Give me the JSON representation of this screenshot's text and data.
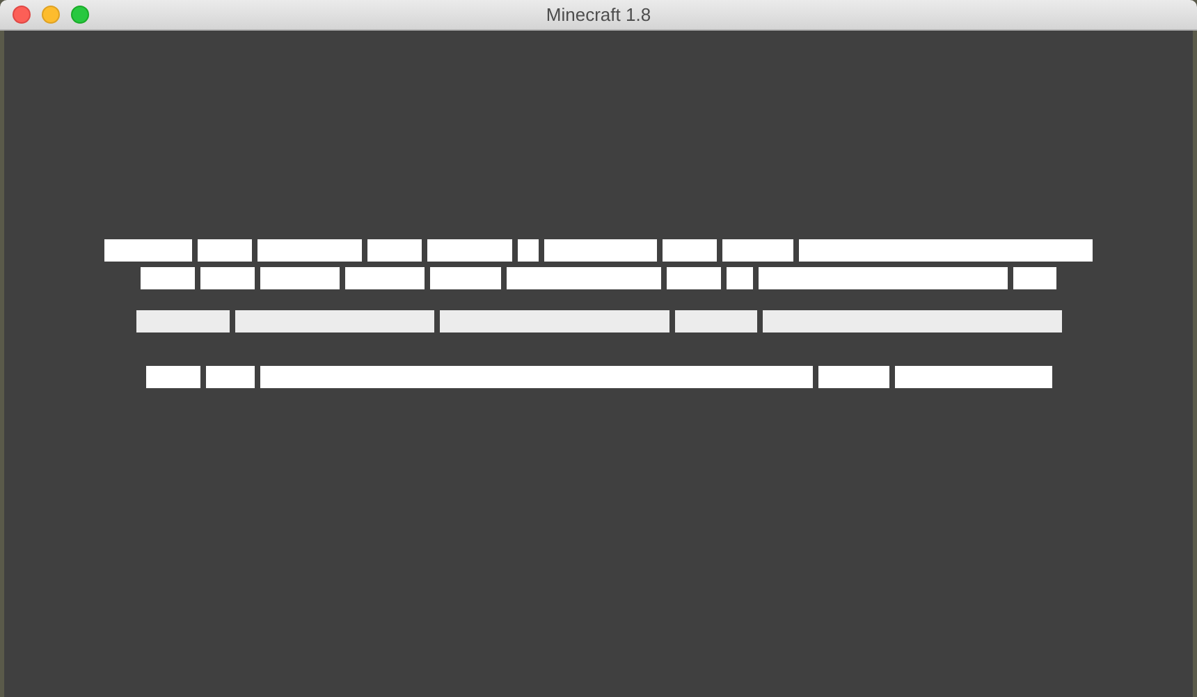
{
  "window": {
    "title": "Minecraft 1.8"
  }
}
